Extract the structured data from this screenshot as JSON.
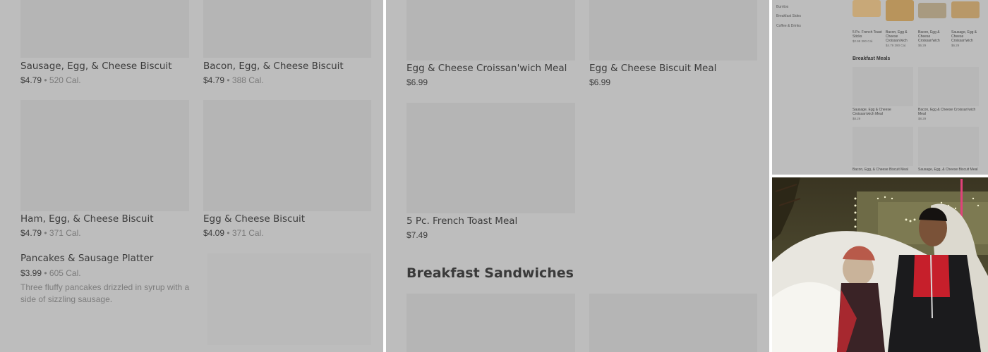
{
  "panel1": {
    "items": [
      {
        "name": "Sausage, Egg, & Cheese Biscuit",
        "price": "$4.79",
        "sep": " • ",
        "cal": "520 Cal."
      },
      {
        "name": "Bacon, Egg, & Cheese Biscuit",
        "price": "$4.79",
        "sep": " • ",
        "cal": "388 Cal."
      },
      {
        "name": "Ham, Egg, & Cheese Biscuit",
        "price": "$4.79",
        "sep": " • ",
        "cal": "371 Cal."
      },
      {
        "name": "Egg & Cheese Biscuit",
        "price": "$4.09",
        "sep": " • ",
        "cal": "371 Cal."
      },
      {
        "name": "Pancakes & Sausage Platter",
        "price": "$3.99",
        "sep": " • ",
        "cal": "605 Cal.",
        "description": "Three fluffy pancakes drizzled in syrup with a side of sizzling sausage."
      }
    ]
  },
  "panel2": {
    "items": [
      {
        "name": "Egg & Cheese Croissan'wich Meal",
        "price": "$6.99"
      },
      {
        "name": "Egg & Cheese Biscuit Meal",
        "price": "$6.99"
      },
      {
        "name": "5 Pc. French Toast Meal",
        "price": "$7.49"
      }
    ],
    "section_title": "Breakfast Sandwiches"
  },
  "panel3": {
    "categories": [
      "Burritos",
      "Breakfast Sides",
      "Coffee & Drinks"
    ],
    "top_items": [
      {
        "name": "5 Pc. French Toast Sticks",
        "price": "$2.99",
        "cal": "390 Cal."
      },
      {
        "name": "Bacon, Egg & Cheese Croissan'wich",
        "price": "$4.79",
        "cal": "390 Cal."
      },
      {
        "name": "Bacon, Egg & Cheese Croissan'wich",
        "price": "$6.29",
        "cal": ""
      },
      {
        "name": "Sausage, Egg & Cheese Croissan'wich",
        "price": "$6.29",
        "cal": ""
      }
    ],
    "section_title": "Breakfast Meals",
    "meals": [
      {
        "name": "Sausage, Egg & Cheese Croissan'wich Meal",
        "price": "$8.29"
      },
      {
        "name": "Bacon, Egg & Cheese Croissan'wich Meal",
        "price": "$8.29"
      },
      {
        "name": "Bacon, Egg, & Cheese Biscuit Meal",
        "price": ""
      },
      {
        "name": "Sausage, Egg, & Cheese Biscuit Meal",
        "price": ""
      }
    ]
  },
  "colors": {
    "panel_overlay": "#bdbdbd",
    "thumb": "#b5b5b5",
    "text": "#3c3c3c",
    "muted": "#7a7a7a"
  }
}
